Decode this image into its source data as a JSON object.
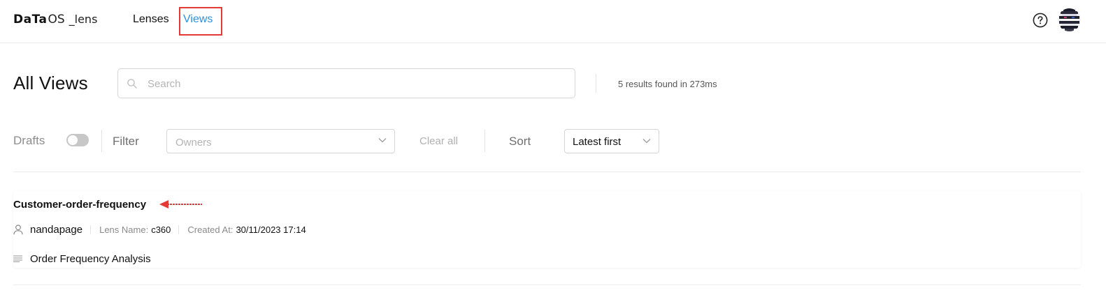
{
  "header": {
    "logo_bold": "DaTa",
    "logo_os": "OS",
    "logo_product": "_lens",
    "nav": [
      {
        "label": "Lenses",
        "active": false
      },
      {
        "label": "Views",
        "active": true
      }
    ],
    "help_icon": "question-circle-icon",
    "avatar_icon": "user-avatar"
  },
  "page": {
    "title": "All Views",
    "search_placeholder": "Search",
    "search_value": "",
    "results_text": "5 results found in 273ms"
  },
  "filters": {
    "drafts_label": "Drafts",
    "drafts_enabled": false,
    "filter_label": "Filter",
    "owners_placeholder": "Owners",
    "clear_all_label": "Clear all",
    "sort_label": "Sort",
    "sort_value": "Latest first"
  },
  "views": [
    {
      "title": "Customer-order-frequency",
      "owner": "nandapage",
      "lens_name_label": "Lens Name:",
      "lens_name": "c360",
      "created_at_label": "Created At:",
      "created_at": "30/11/2023 17:14",
      "description": "Order Frequency Analysis"
    }
  ],
  "colors": {
    "accent": "#2d8fe0",
    "annotation": "#e53935",
    "muted": "#8a8a8a"
  }
}
